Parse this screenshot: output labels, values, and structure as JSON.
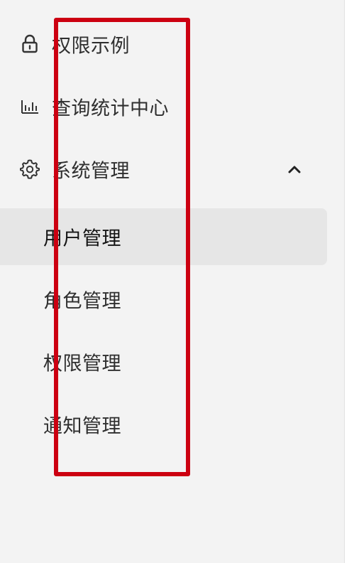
{
  "menu": {
    "items": [
      {
        "label": "权限示例",
        "icon": "lock-icon"
      },
      {
        "label": "查询统计中心",
        "icon": "bar-chart-icon"
      },
      {
        "label": "系统管理",
        "icon": "gear-icon",
        "expanded": true,
        "expand_icon": "chevron-up-icon"
      }
    ],
    "submenu": [
      {
        "label": "用户管理",
        "active": true
      },
      {
        "label": "角色管理",
        "active": false
      },
      {
        "label": "权限管理",
        "active": false
      },
      {
        "label": "通知管理",
        "active": false
      }
    ]
  },
  "colors": {
    "sidebar_bg": "#f3f3f3",
    "active_bg": "#e6e6e6",
    "text": "#2f2f2f",
    "annotation_box": "#cc0011"
  }
}
